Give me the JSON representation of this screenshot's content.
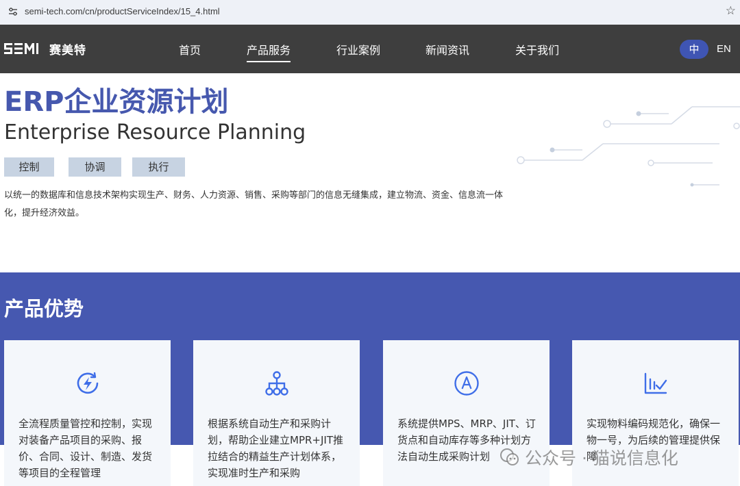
{
  "browser": {
    "url": "semi-tech.com/cn/productServiceIndex/15_4.html"
  },
  "nav": {
    "logo_text": "SEMI",
    "logo_cn": "赛美特",
    "items": [
      "首页",
      "产品服务",
      "行业案例",
      "新闻资讯",
      "关于我们"
    ],
    "active_index": 1,
    "lang_zh": "中",
    "lang_en": "EN"
  },
  "hero": {
    "title": "ERP企业资源计划",
    "subtitle": "Enterprise Resource Planning",
    "tags": [
      "控制",
      "协调",
      "执行"
    ],
    "description": "以统一的数据库和信息技术架构实现生产、财务、人力资源、销售、采购等部门的信息无缝集成，建立物流、资金、信息流一体化，提升经济效益。"
  },
  "advantages": {
    "title": "产品优势",
    "cards": [
      {
        "icon": "lightning-circle-icon",
        "text": "全流程质量管控和控制，实现对装备产品项目的采购、报价、合同、设计、制造、发货等项目的全程管理"
      },
      {
        "icon": "hierarchy-icon",
        "text": "根据系统自动生产和采购计划，帮助企业建立MPR+JIT推拉结合的精益生产计划体系，实现准时生产和采购"
      },
      {
        "icon": "letter-a-circle-icon",
        "text": "系统提供MPS、MRP、JIT、订货点和自动库存等多种计划方法自动生成采购计划"
      },
      {
        "icon": "checklist-chart-icon",
        "text": "实现物料编码规范化，确保一物一号，为后续的管理提供保障"
      }
    ]
  },
  "watermark": {
    "text": "公众号 · 猫说信息化"
  },
  "colors": {
    "nav_bg": "#3e3e3e",
    "brand_blue": "#4658b0",
    "tag_bg": "#c7d3e2",
    "card_bg": "#f4f7fb",
    "icon_blue": "#3f6ee8"
  }
}
